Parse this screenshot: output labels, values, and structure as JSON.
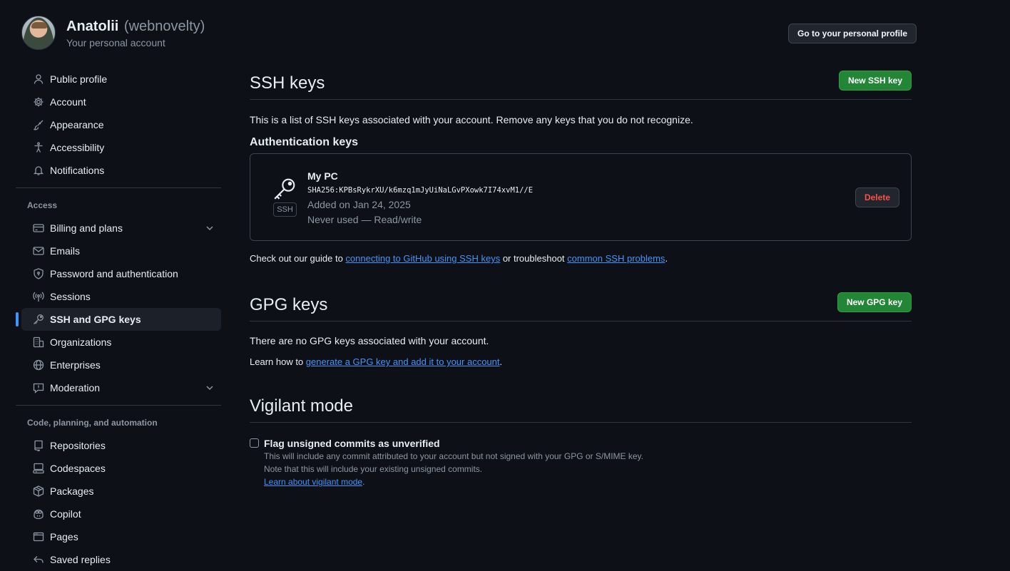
{
  "header": {
    "name": "Anatolii",
    "login": "(webnovelty)",
    "subtitle": "Your personal account",
    "profile_button": "Go to your personal profile"
  },
  "sidebar": {
    "items_top": [
      {
        "label": "Public profile",
        "icon": "person-icon"
      },
      {
        "label": "Account",
        "icon": "gear-icon"
      },
      {
        "label": "Appearance",
        "icon": "paintbrush-icon"
      },
      {
        "label": "Accessibility",
        "icon": "accessibility-icon"
      },
      {
        "label": "Notifications",
        "icon": "bell-icon"
      }
    ],
    "access_heading": "Access",
    "items_access": [
      {
        "label": "Billing and plans",
        "icon": "credit-card-icon",
        "expandable": true
      },
      {
        "label": "Emails",
        "icon": "mail-icon"
      },
      {
        "label": "Password and authentication",
        "icon": "shield-lock-icon"
      },
      {
        "label": "Sessions",
        "icon": "broadcast-icon"
      },
      {
        "label": "SSH and GPG keys",
        "icon": "key-icon",
        "active": true
      },
      {
        "label": "Organizations",
        "icon": "organization-icon"
      },
      {
        "label": "Enterprises",
        "icon": "globe-icon"
      },
      {
        "label": "Moderation",
        "icon": "report-icon",
        "expandable": true
      }
    ],
    "code_heading": "Code, planning, and automation",
    "items_code": [
      {
        "label": "Repositories",
        "icon": "repo-icon"
      },
      {
        "label": "Codespaces",
        "icon": "codespaces-icon"
      },
      {
        "label": "Packages",
        "icon": "package-icon"
      },
      {
        "label": "Copilot",
        "icon": "copilot-icon"
      },
      {
        "label": "Pages",
        "icon": "browser-icon"
      },
      {
        "label": "Saved replies",
        "icon": "reply-icon"
      }
    ]
  },
  "ssh": {
    "title": "SSH keys",
    "new_button": "New SSH key",
    "description": "This is a list of SSH keys associated with your account. Remove any keys that you do not recognize.",
    "auth_heading": "Authentication keys",
    "key": {
      "title": "My PC",
      "badge": "SSH",
      "fingerprint": "SHA256:KPBsRykrXU/k6mzq1mJyUiNaLGvPXowk7I74xvM1//E",
      "added": "Added on Jan 24, 2025",
      "usage": "Never used — Read/write",
      "delete_button": "Delete"
    },
    "guide_prefix": "Check out our guide to ",
    "guide_link": "connecting to GitHub using SSH keys",
    "guide_middle": " or troubleshoot ",
    "guide_link2": "common SSH problems",
    "guide_suffix": "."
  },
  "gpg": {
    "title": "GPG keys",
    "new_button": "New GPG key",
    "empty_text": "There are no GPG keys associated with your account.",
    "learn_prefix": "Learn how to ",
    "learn_link": "generate a GPG key and add it to your account",
    "learn_suffix": "."
  },
  "vigilant": {
    "title": "Vigilant mode",
    "checkbox_label": "Flag unsigned commits as unverified",
    "checked": false,
    "note1": "This will include any commit attributed to your account but not signed with your GPG or S/MIME key.",
    "note2": "Note that this will include your existing unsigned commits.",
    "learn_link": "Learn about vigilant mode",
    "learn_suffix": "."
  },
  "colors": {
    "background": "#0d1117",
    "accent": "#4493f8",
    "green_button": "#238636",
    "danger": "#f85149",
    "muted_text": "#8d96a0",
    "border": "#30363d"
  }
}
